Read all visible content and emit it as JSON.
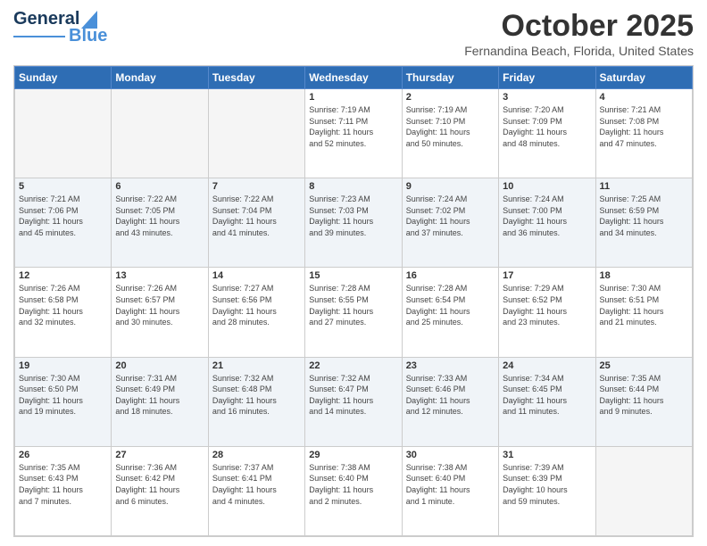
{
  "header": {
    "logo": {
      "line1": "General",
      "line2": "Blue"
    },
    "title": "October 2025",
    "location": "Fernandina Beach, Florida, United States"
  },
  "calendar": {
    "days_of_week": [
      "Sunday",
      "Monday",
      "Tuesday",
      "Wednesday",
      "Thursday",
      "Friday",
      "Saturday"
    ],
    "weeks": [
      [
        {
          "day": "",
          "info": ""
        },
        {
          "day": "",
          "info": ""
        },
        {
          "day": "",
          "info": ""
        },
        {
          "day": "1",
          "info": "Sunrise: 7:19 AM\nSunset: 7:11 PM\nDaylight: 11 hours\nand 52 minutes."
        },
        {
          "day": "2",
          "info": "Sunrise: 7:19 AM\nSunset: 7:10 PM\nDaylight: 11 hours\nand 50 minutes."
        },
        {
          "day": "3",
          "info": "Sunrise: 7:20 AM\nSunset: 7:09 PM\nDaylight: 11 hours\nand 48 minutes."
        },
        {
          "day": "4",
          "info": "Sunrise: 7:21 AM\nSunset: 7:08 PM\nDaylight: 11 hours\nand 47 minutes."
        }
      ],
      [
        {
          "day": "5",
          "info": "Sunrise: 7:21 AM\nSunset: 7:06 PM\nDaylight: 11 hours\nand 45 minutes."
        },
        {
          "day": "6",
          "info": "Sunrise: 7:22 AM\nSunset: 7:05 PM\nDaylight: 11 hours\nand 43 minutes."
        },
        {
          "day": "7",
          "info": "Sunrise: 7:22 AM\nSunset: 7:04 PM\nDaylight: 11 hours\nand 41 minutes."
        },
        {
          "day": "8",
          "info": "Sunrise: 7:23 AM\nSunset: 7:03 PM\nDaylight: 11 hours\nand 39 minutes."
        },
        {
          "day": "9",
          "info": "Sunrise: 7:24 AM\nSunset: 7:02 PM\nDaylight: 11 hours\nand 37 minutes."
        },
        {
          "day": "10",
          "info": "Sunrise: 7:24 AM\nSunset: 7:00 PM\nDaylight: 11 hours\nand 36 minutes."
        },
        {
          "day": "11",
          "info": "Sunrise: 7:25 AM\nSunset: 6:59 PM\nDaylight: 11 hours\nand 34 minutes."
        }
      ],
      [
        {
          "day": "12",
          "info": "Sunrise: 7:26 AM\nSunset: 6:58 PM\nDaylight: 11 hours\nand 32 minutes."
        },
        {
          "day": "13",
          "info": "Sunrise: 7:26 AM\nSunset: 6:57 PM\nDaylight: 11 hours\nand 30 minutes."
        },
        {
          "day": "14",
          "info": "Sunrise: 7:27 AM\nSunset: 6:56 PM\nDaylight: 11 hours\nand 28 minutes."
        },
        {
          "day": "15",
          "info": "Sunrise: 7:28 AM\nSunset: 6:55 PM\nDaylight: 11 hours\nand 27 minutes."
        },
        {
          "day": "16",
          "info": "Sunrise: 7:28 AM\nSunset: 6:54 PM\nDaylight: 11 hours\nand 25 minutes."
        },
        {
          "day": "17",
          "info": "Sunrise: 7:29 AM\nSunset: 6:52 PM\nDaylight: 11 hours\nand 23 minutes."
        },
        {
          "day": "18",
          "info": "Sunrise: 7:30 AM\nSunset: 6:51 PM\nDaylight: 11 hours\nand 21 minutes."
        }
      ],
      [
        {
          "day": "19",
          "info": "Sunrise: 7:30 AM\nSunset: 6:50 PM\nDaylight: 11 hours\nand 19 minutes."
        },
        {
          "day": "20",
          "info": "Sunrise: 7:31 AM\nSunset: 6:49 PM\nDaylight: 11 hours\nand 18 minutes."
        },
        {
          "day": "21",
          "info": "Sunrise: 7:32 AM\nSunset: 6:48 PM\nDaylight: 11 hours\nand 16 minutes."
        },
        {
          "day": "22",
          "info": "Sunrise: 7:32 AM\nSunset: 6:47 PM\nDaylight: 11 hours\nand 14 minutes."
        },
        {
          "day": "23",
          "info": "Sunrise: 7:33 AM\nSunset: 6:46 PM\nDaylight: 11 hours\nand 12 minutes."
        },
        {
          "day": "24",
          "info": "Sunrise: 7:34 AM\nSunset: 6:45 PM\nDaylight: 11 hours\nand 11 minutes."
        },
        {
          "day": "25",
          "info": "Sunrise: 7:35 AM\nSunset: 6:44 PM\nDaylight: 11 hours\nand 9 minutes."
        }
      ],
      [
        {
          "day": "26",
          "info": "Sunrise: 7:35 AM\nSunset: 6:43 PM\nDaylight: 11 hours\nand 7 minutes."
        },
        {
          "day": "27",
          "info": "Sunrise: 7:36 AM\nSunset: 6:42 PM\nDaylight: 11 hours\nand 6 minutes."
        },
        {
          "day": "28",
          "info": "Sunrise: 7:37 AM\nSunset: 6:41 PM\nDaylight: 11 hours\nand 4 minutes."
        },
        {
          "day": "29",
          "info": "Sunrise: 7:38 AM\nSunset: 6:40 PM\nDaylight: 11 hours\nand 2 minutes."
        },
        {
          "day": "30",
          "info": "Sunrise: 7:38 AM\nSunset: 6:40 PM\nDaylight: 11 hours\nand 1 minute."
        },
        {
          "day": "31",
          "info": "Sunrise: 7:39 AM\nSunset: 6:39 PM\nDaylight: 10 hours\nand 59 minutes."
        },
        {
          "day": "",
          "info": ""
        }
      ]
    ]
  }
}
